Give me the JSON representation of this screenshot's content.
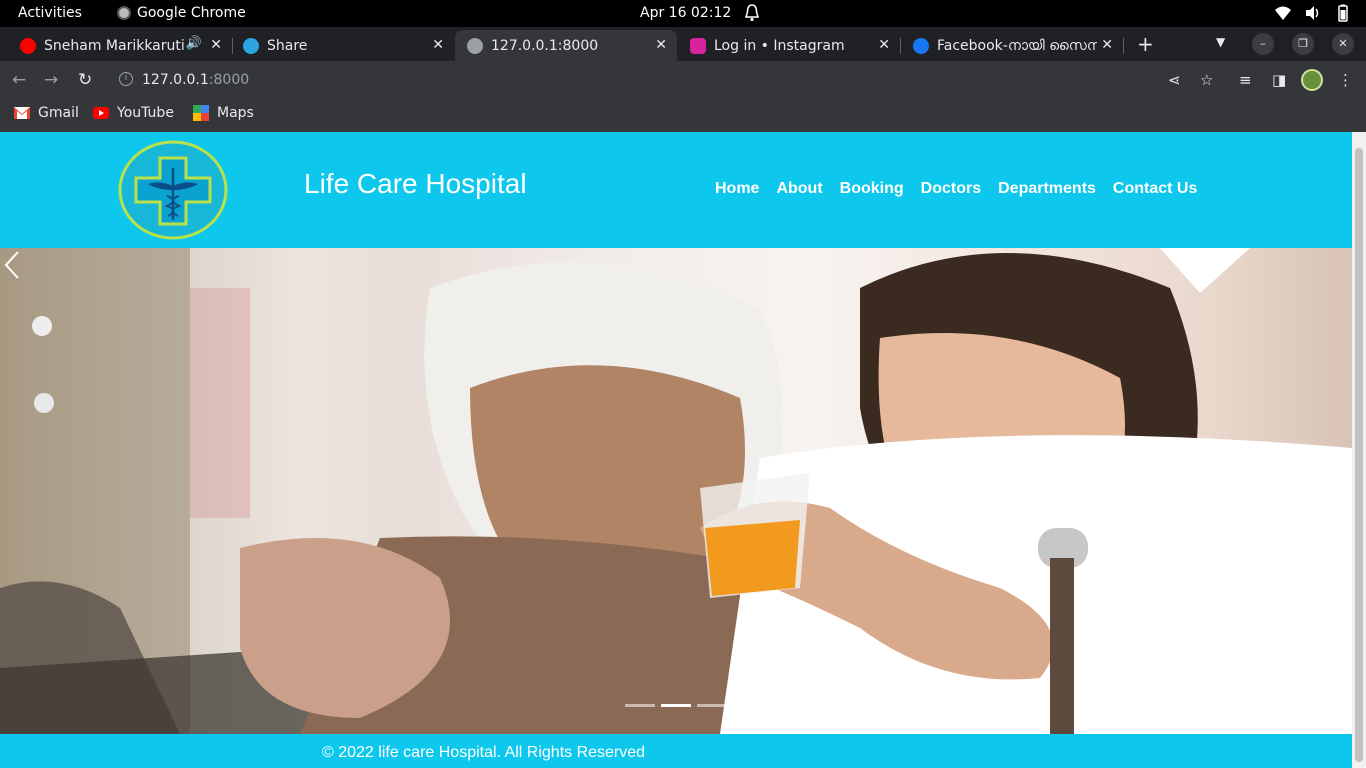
{
  "system_bar": {
    "activities": "Activities",
    "app_name": "Google Chrome",
    "clock": "Apr 16  02:12"
  },
  "tabs": [
    {
      "title": "Sneham Marikkaruti",
      "favicon": "youtube-icon",
      "color": "#ff0000",
      "audio": true
    },
    {
      "title": "Share",
      "favicon": "telegram-icon",
      "color": "#2ca5e0"
    },
    {
      "title": "127.0.0.1:8000",
      "favicon": "globe-icon",
      "color": "#9aa0a6",
      "active": true
    },
    {
      "title": "Log in • Instagram",
      "favicon": "instagram-icon",
      "color": "#d6249f"
    },
    {
      "title": "Facebook-നായി സൈനപ്പ്",
      "favicon": "facebook-icon",
      "color": "#1877f2"
    }
  ],
  "omnibox": {
    "host": "127.0.0.1",
    "port": ":8000"
  },
  "bookmarks": [
    {
      "label": "Gmail",
      "icon": "gmail-icon"
    },
    {
      "label": "YouTube",
      "icon": "youtube-icon"
    },
    {
      "label": "Maps",
      "icon": "maps-icon"
    }
  ],
  "site": {
    "title": "Life Care Hospital",
    "nav": [
      "Home",
      "About",
      "Booking",
      "Doctors",
      "Departments",
      "Contact Us"
    ],
    "footer": "© 2022 life care Hospital. All Rights Reserved",
    "accent_color": "#0dc8ec",
    "carousel": {
      "slides": 3,
      "active_slide": 2
    }
  }
}
